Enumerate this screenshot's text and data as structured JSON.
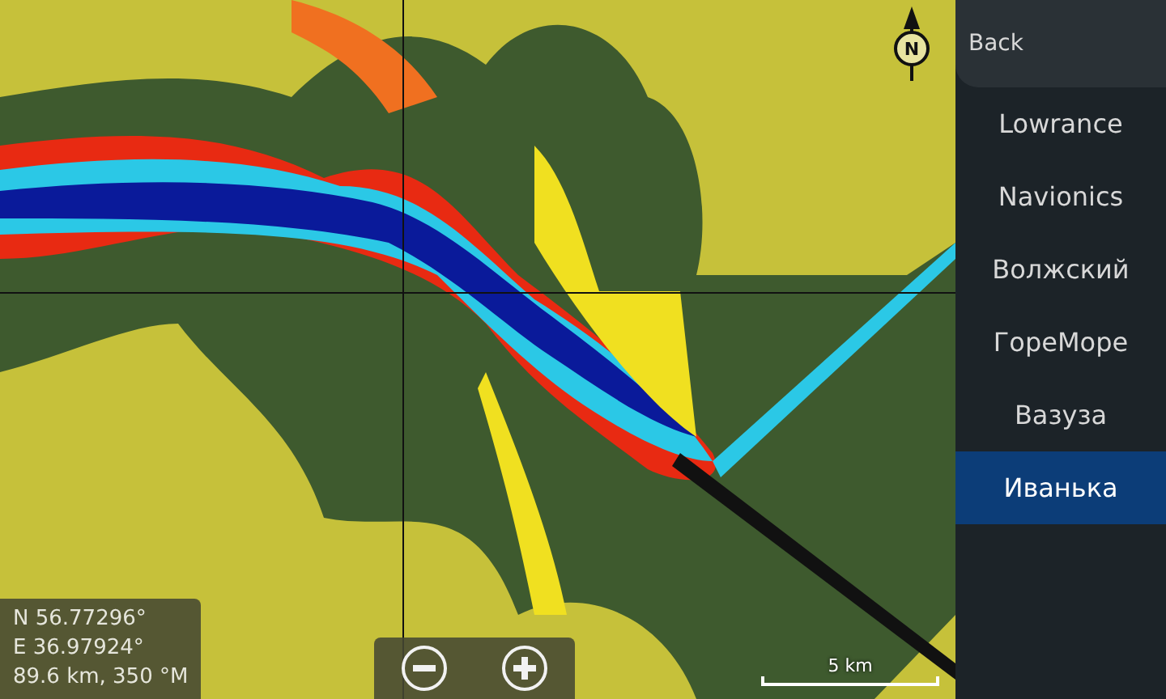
{
  "map": {
    "compass": "N",
    "scale": "5 km",
    "position": [
      "N  56.77296°",
      "E  36.97924°",
      "89.6 km, 350 °M"
    ]
  },
  "sidebar": {
    "back": "Back",
    "items": [
      {
        "label": "Lowrance",
        "selected": false
      },
      {
        "label": "Navionics",
        "selected": false
      },
      {
        "label": "Волжский",
        "selected": false
      },
      {
        "label": "ГореМоре",
        "selected": false
      },
      {
        "label": "Вазуза",
        "selected": false
      },
      {
        "label": "Иванька",
        "selected": true
      }
    ]
  }
}
